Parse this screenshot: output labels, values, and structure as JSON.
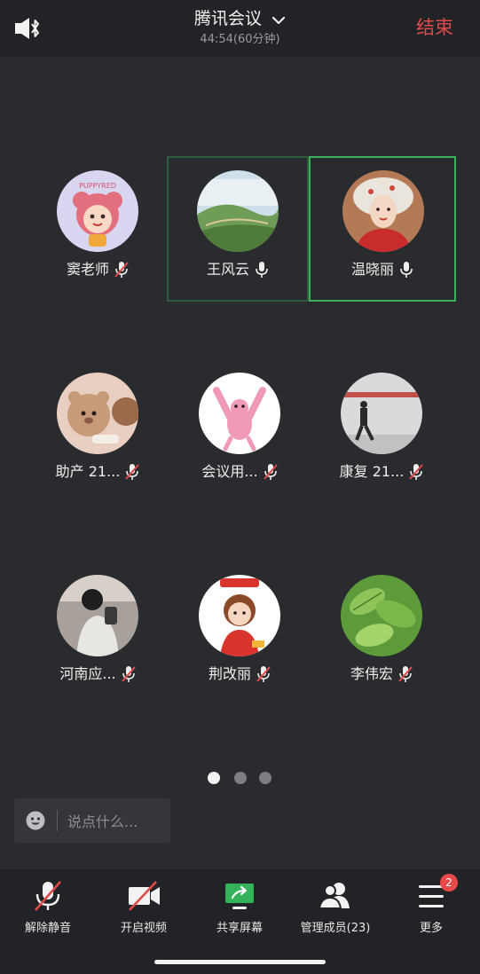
{
  "header": {
    "title": "腾讯会议",
    "subtitle": "44:54(60分钟)",
    "end_label": "结束"
  },
  "participants": [
    {
      "name": "窦老师",
      "mic": "muted",
      "avatar": "cartoon-bear-girl-icon"
    },
    {
      "name": "王风云",
      "mic": "on",
      "avatar": "mountain-landscape-icon"
    },
    {
      "name": "温晓丽",
      "mic": "on",
      "avatar": "woman-portrait-icon"
    },
    {
      "name": "助产 21...",
      "mic": "muted",
      "avatar": "teddy-bears-icon"
    },
    {
      "name": "会议用...",
      "mic": "muted",
      "avatar": "pink-panther-icon"
    },
    {
      "name": "康复 21...",
      "mic": "muted",
      "avatar": "walking-man-photo-icon"
    },
    {
      "name": "河南应...",
      "mic": "muted",
      "avatar": "person-photo-icon"
    },
    {
      "name": "荆改丽",
      "mic": "muted",
      "avatar": "cartoon-girl-red-icon"
    },
    {
      "name": "李伟宏",
      "mic": "muted",
      "avatar": "green-leaves-icon"
    }
  ],
  "pages": {
    "count": 3,
    "active": 1
  },
  "chat": {
    "placeholder": "说点什么..."
  },
  "toolbar": {
    "unmute_label": "解除静音",
    "video_label": "开启视频",
    "share_label": "共享屏幕",
    "members_label": "管理成员(23)",
    "more_label": "更多",
    "more_badge": "2"
  },
  "colors": {
    "background": "#2a2b2f",
    "bar": "#222327",
    "end": "#e24a4a",
    "speaking_border": "#3cae5c",
    "share_green": "#34b35a",
    "badge": "#e84a4a"
  }
}
